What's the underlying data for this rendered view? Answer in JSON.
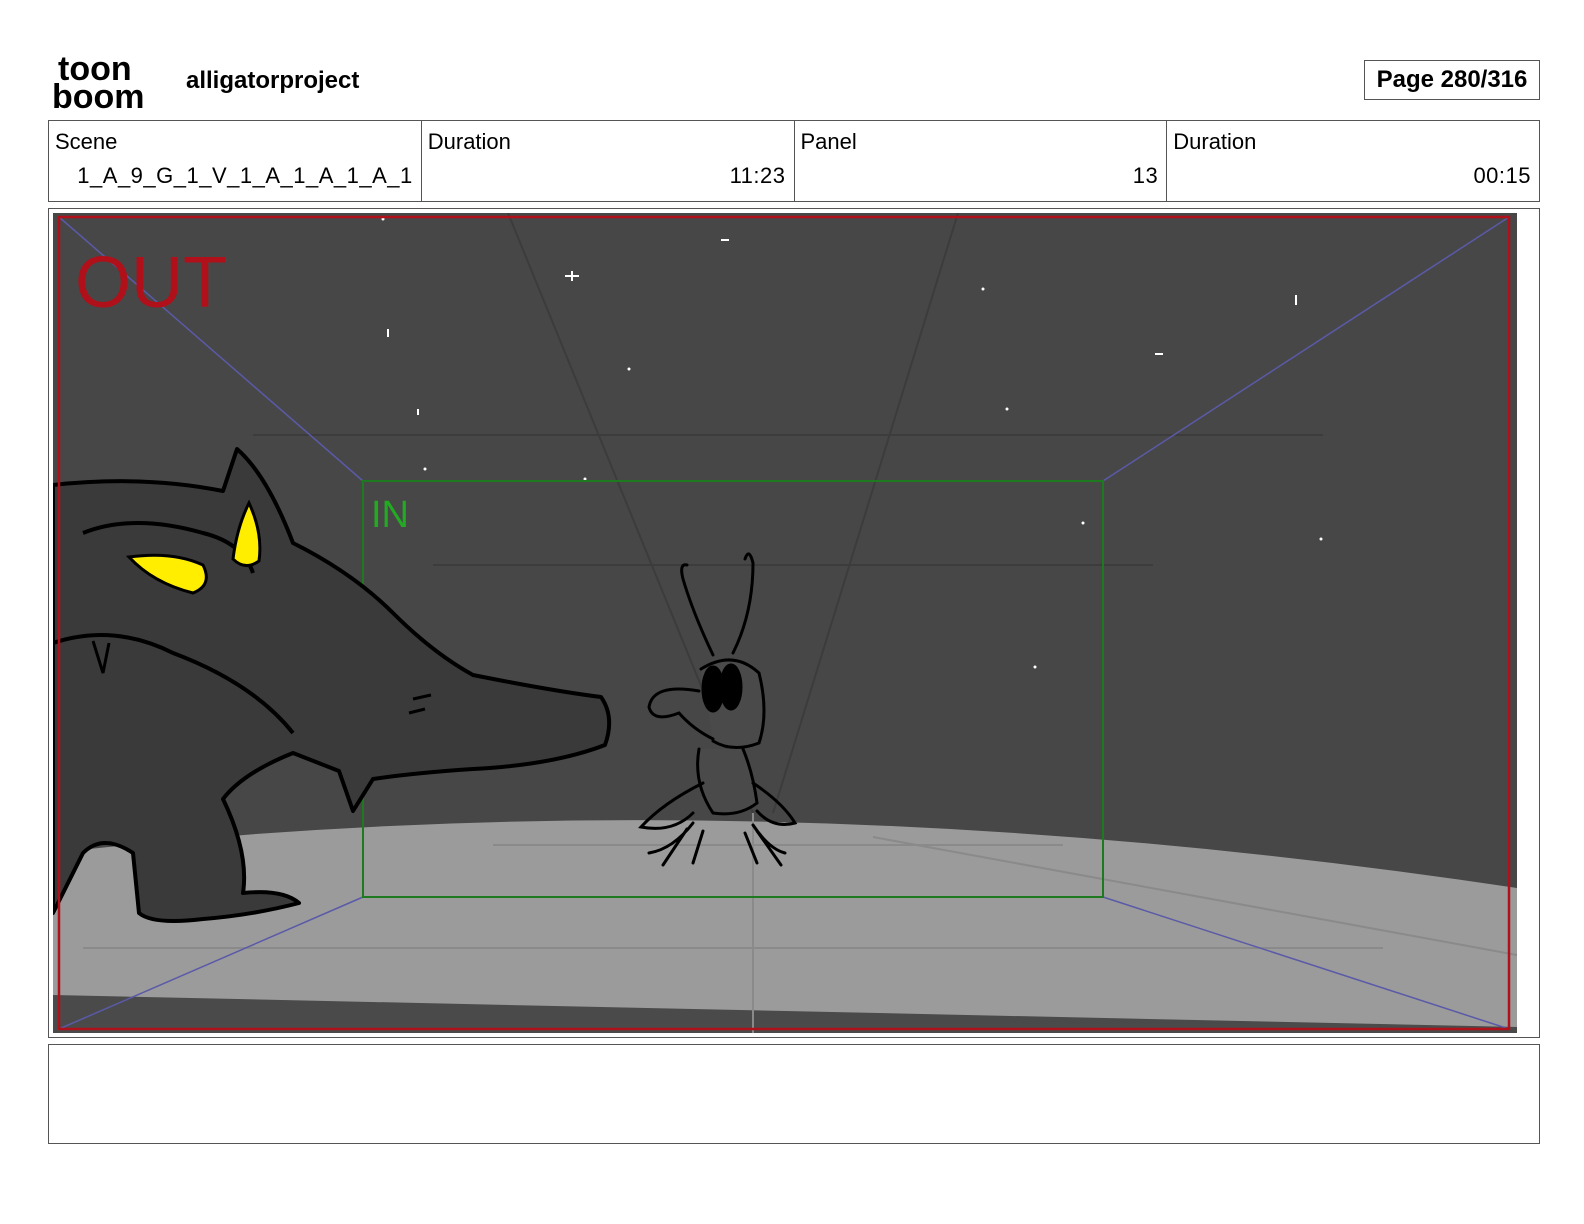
{
  "header": {
    "logo_top": "toon",
    "logo_bottom": "boom",
    "project_name": "alligatorproject",
    "page_label": "Page 280/316"
  },
  "info": {
    "scene_label": "Scene",
    "scene_value": "1_A_9_G_1_V_1_A_1_A_1_A_1",
    "scene_duration_label": "Duration",
    "scene_duration_value": "11:23",
    "panel_label": "Panel",
    "panel_value": "13",
    "panel_duration_label": "Duration",
    "panel_duration_value": "00:15"
  },
  "panel": {
    "out_label": "OUT",
    "in_label": "IN",
    "colors": {
      "sky": "#474747",
      "ground": "#9b9b9b",
      "out_frame": "#b0101a",
      "in_frame": "#1e7a1e",
      "perspective_lines": "#5a5aa8",
      "creature_body": "#3a3a3a",
      "creature_eyes": "#ffee00"
    }
  },
  "notes": {
    "text": ""
  }
}
